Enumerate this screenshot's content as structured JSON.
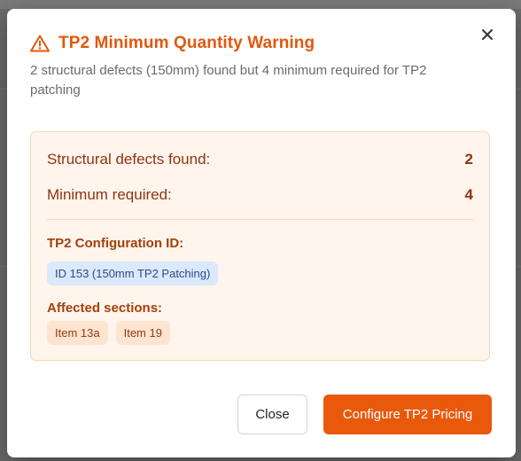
{
  "dialog": {
    "title": "TP2 Minimum Quantity Warning",
    "subtitle": "2 structural defects (150mm) found but 4 minimum required for TP2 patching",
    "icon": "warning-triangle-icon",
    "accent_color": "#e0590d"
  },
  "stats": {
    "found_label": "Structural defects found:",
    "found_value": "2",
    "required_label": "Minimum required:",
    "required_value": "4"
  },
  "config": {
    "label": "TP2 Configuration ID:",
    "id_chip": "ID 153 (150mm TP2 Patching)"
  },
  "affected": {
    "label": "Affected sections:",
    "items": [
      "Item 13a",
      "Item 19"
    ]
  },
  "footer": {
    "close_label": "Close",
    "configure_label": "Configure TP2 Pricing",
    "primary_color": "#e8590c"
  }
}
